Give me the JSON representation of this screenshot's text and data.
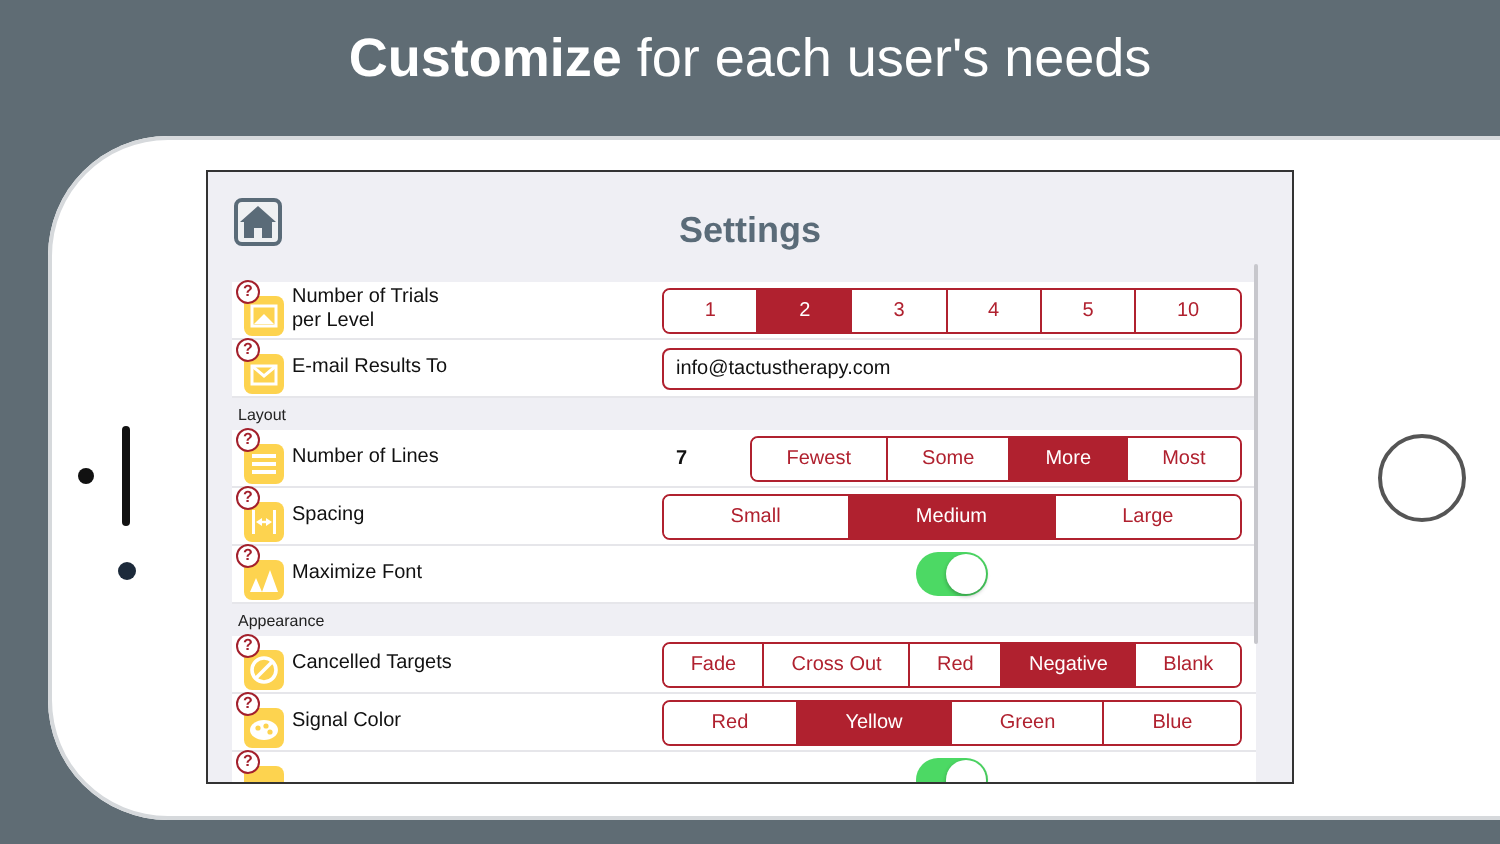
{
  "headline": "**Customize** for each user's needs",
  "screen": {
    "title": "Settings",
    "rows": [
      {
        "kind": "segmented",
        "help": "?",
        "label": "Number of Trials\nper Level",
        "options": [
          {
            "label": "1",
            "selected": false
          },
          {
            "label": "2",
            "selected": true
          },
          {
            "label": "3",
            "selected": false
          },
          {
            "label": "4",
            "selected": false
          },
          {
            "label": "5",
            "selected": false
          },
          {
            "label": "10",
            "selected": false
          }
        ]
      },
      {
        "kind": "field",
        "help": "?",
        "label": "E-mail Results To",
        "value": "info@tactustherapy.com"
      },
      {
        "kind": "header",
        "label": "Layout"
      },
      {
        "kind": "segmented",
        "help": "?",
        "label": "Number of Lines",
        "value": "7",
        "options": [
          {
            "label": "Fewest",
            "selected": false
          },
          {
            "label": "Some",
            "selected": false
          },
          {
            "label": "More",
            "selected": true
          },
          {
            "label": "Most",
            "selected": false
          }
        ]
      },
      {
        "kind": "segmented",
        "help": "?",
        "label": "Spacing",
        "options": [
          {
            "label": "Small",
            "selected": false
          },
          {
            "label": "Medium",
            "selected": true
          },
          {
            "label": "Large",
            "selected": false
          }
        ]
      },
      {
        "kind": "toggle",
        "help": "?",
        "label": "Maximize Font",
        "on": true
      },
      {
        "kind": "header",
        "label": "Appearance"
      },
      {
        "kind": "segmented",
        "help": "?",
        "label": "Cancelled Targets",
        "options": [
          {
            "label": "Fade",
            "selected": false
          },
          {
            "label": "Cross Out",
            "selected": false
          },
          {
            "label": "Red",
            "selected": false
          },
          {
            "label": "Negative",
            "selected": true
          },
          {
            "label": "Blank",
            "selected": false
          }
        ]
      },
      {
        "kind": "segmented",
        "help": "?",
        "label": "Signal Color",
        "options": [
          {
            "label": "Red",
            "selected": false
          },
          {
            "label": "Yellow",
            "selected": true
          },
          {
            "label": "Green",
            "selected": false
          },
          {
            "label": "Blue",
            "selected": false
          }
        ]
      },
      {
        "kind": "toggle",
        "help": "?",
        "on": true
      }
    ]
  }
}
